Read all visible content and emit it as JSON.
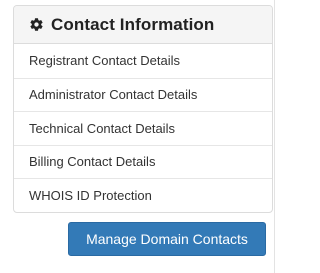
{
  "panel": {
    "title": "Contact Information",
    "icon": "gear-icon",
    "items": [
      {
        "label": "Registrant Contact Details"
      },
      {
        "label": "Administrator Contact Details"
      },
      {
        "label": "Technical Contact Details"
      },
      {
        "label": "Billing Contact Details"
      },
      {
        "label": "WHOIS ID Protection"
      }
    ]
  },
  "actions": {
    "manage_label": "Manage Domain Contacts"
  },
  "colors": {
    "primary": "#337ab7",
    "header_bg": "#f5f5f5",
    "border": "#dcdcdc"
  }
}
